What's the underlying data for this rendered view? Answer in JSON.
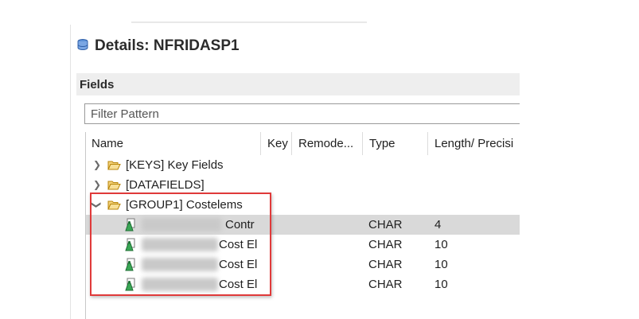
{
  "header": {
    "title": "Details: NFRIDASP1",
    "icon": "database-icon"
  },
  "fields_section": {
    "label": "Fields"
  },
  "filter": {
    "placeholder": "Filter Pattern",
    "value": ""
  },
  "columns": [
    "Name",
    "Key",
    "Remode...",
    "Type",
    "Length/ Precisi"
  ],
  "tree": {
    "folders": [
      {
        "label": "[KEYS] Key Fields",
        "expanded": false
      },
      {
        "label": "[DATAFIELDS]",
        "expanded": false
      },
      {
        "label": "[GROUP1] Costelems",
        "expanded": true
      }
    ],
    "rows": [
      {
        "name_suffix": "Contr",
        "type": "CHAR",
        "length": "4",
        "selected": true
      },
      {
        "name_suffix": "Cost El",
        "type": "CHAR",
        "length": "10",
        "selected": false
      },
      {
        "name_suffix": "Cost El",
        "type": "CHAR",
        "length": "10",
        "selected": false
      },
      {
        "name_suffix": "Cost El",
        "type": "CHAR",
        "length": "10",
        "selected": false
      }
    ]
  },
  "colors": {
    "highlight": "#e03a3a",
    "selected_row": "#d9d9d9",
    "header_bar": "#eeeeee"
  }
}
